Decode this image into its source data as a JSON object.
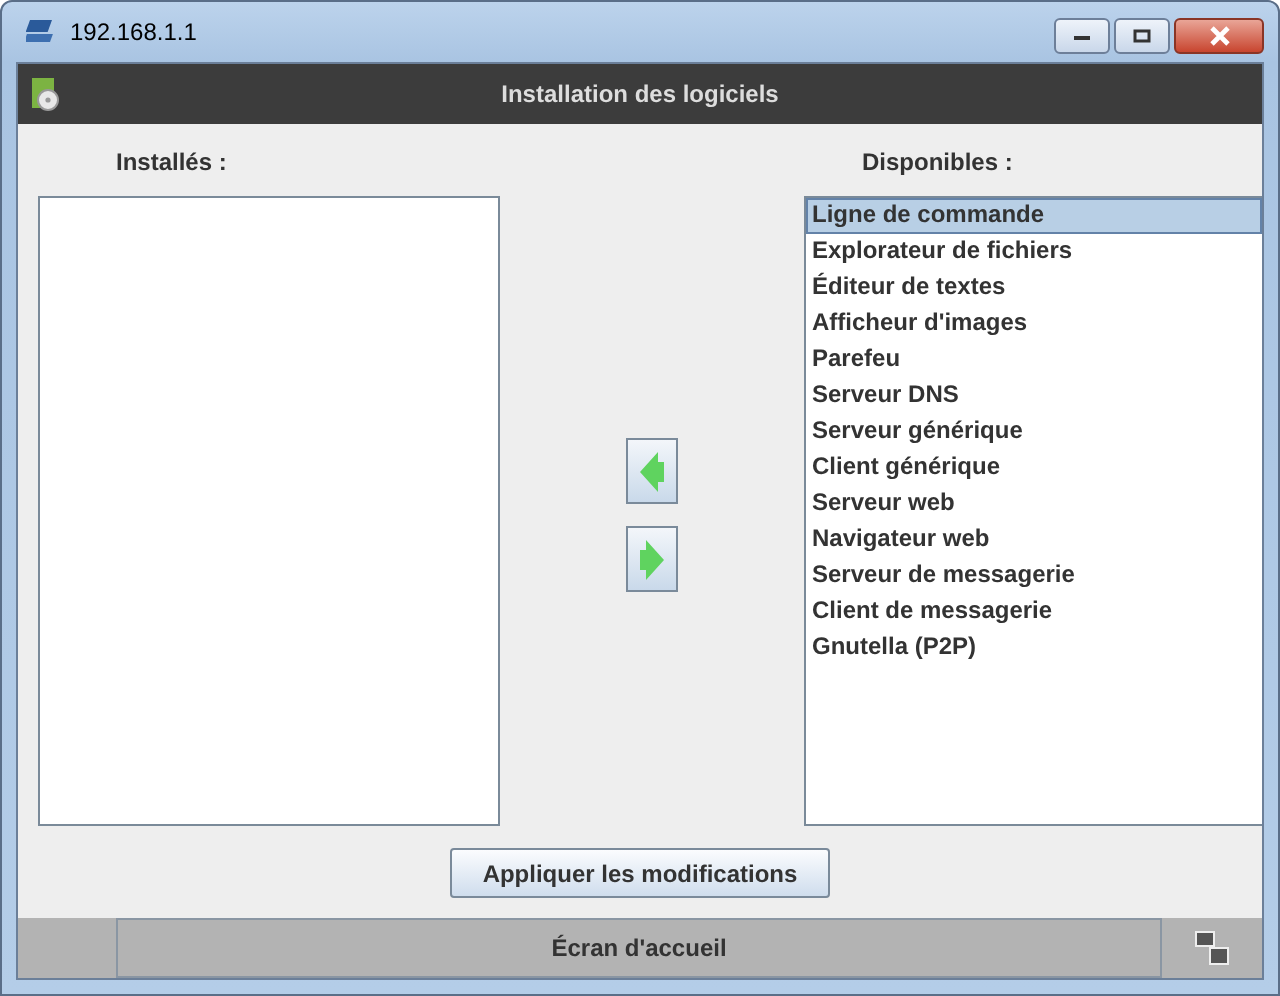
{
  "window": {
    "title": "192.168.1.1"
  },
  "header": {
    "title": "Installation des logiciels"
  },
  "installed": {
    "label": "Installés :"
  },
  "available": {
    "label": "Disponibles :",
    "items": [
      {
        "label": "Ligne de commande",
        "selected": true
      },
      {
        "label": "Explorateur de fichiers",
        "selected": false
      },
      {
        "label": "Éditeur de textes",
        "selected": false
      },
      {
        "label": "Afficheur d'images",
        "selected": false
      },
      {
        "label": "Parefeu",
        "selected": false
      },
      {
        "label": "Serveur DNS",
        "selected": false
      },
      {
        "label": "Serveur générique",
        "selected": false
      },
      {
        "label": "Client générique",
        "selected": false
      },
      {
        "label": "Serveur web",
        "selected": false
      },
      {
        "label": "Navigateur web",
        "selected": false
      },
      {
        "label": "Serveur de messagerie",
        "selected": false
      },
      {
        "label": "Client de messagerie",
        "selected": false
      },
      {
        "label": "Gnutella (P2P)",
        "selected": false
      }
    ]
  },
  "apply_button": "Appliquer les modifications",
  "footer": {
    "button": "Écran d'accueil"
  }
}
